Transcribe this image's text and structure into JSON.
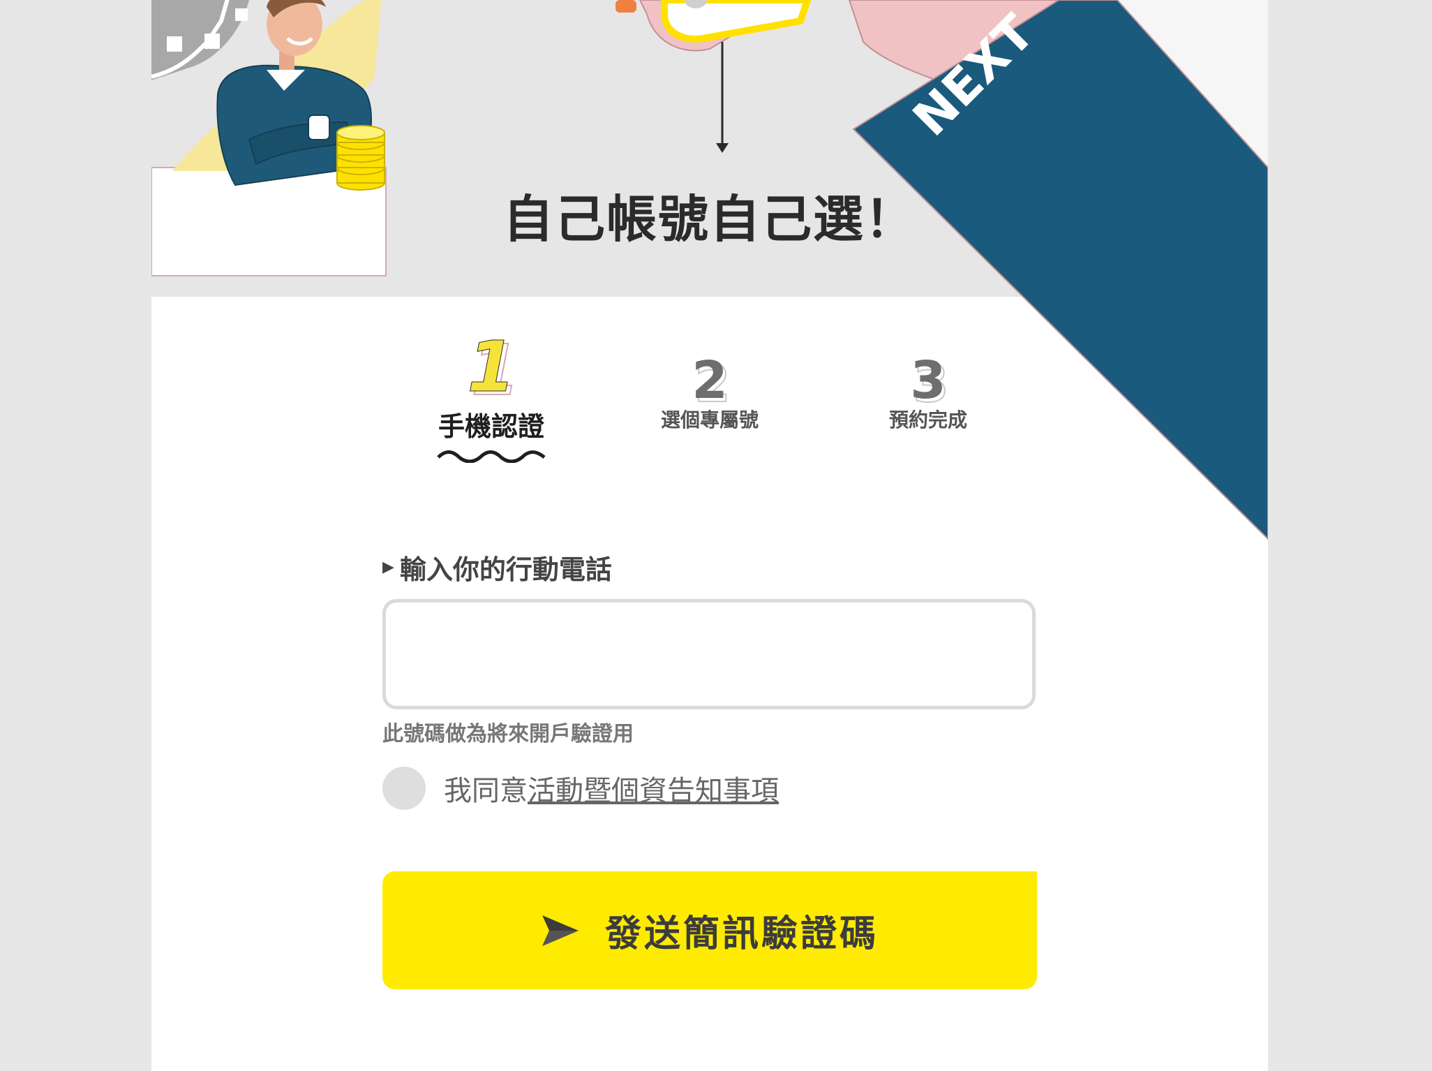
{
  "hero": {
    "title": "自己帳號自己選！",
    "sleeve_text": "NEXT"
  },
  "steps": [
    {
      "number": "1",
      "label": "手機認證",
      "active": true
    },
    {
      "number": "2",
      "label": "選個專屬號",
      "active": false
    },
    {
      "number": "3",
      "label": "預約完成",
      "active": false
    }
  ],
  "form": {
    "phone_label": "輸入你的行動電話",
    "phone_value": "",
    "phone_hint": "此號碼做為將來開戶驗證用",
    "agree_prefix": "我同意",
    "agree_link": "活動暨個資告知事項"
  },
  "send_button": {
    "label": "發送簡訊驗證碼",
    "icon": "paper-plane-icon"
  },
  "colors": {
    "brand_yellow": "#ffeb00",
    "brand_navy": "#1a5a7d",
    "background_gray": "#e7e7e7"
  }
}
